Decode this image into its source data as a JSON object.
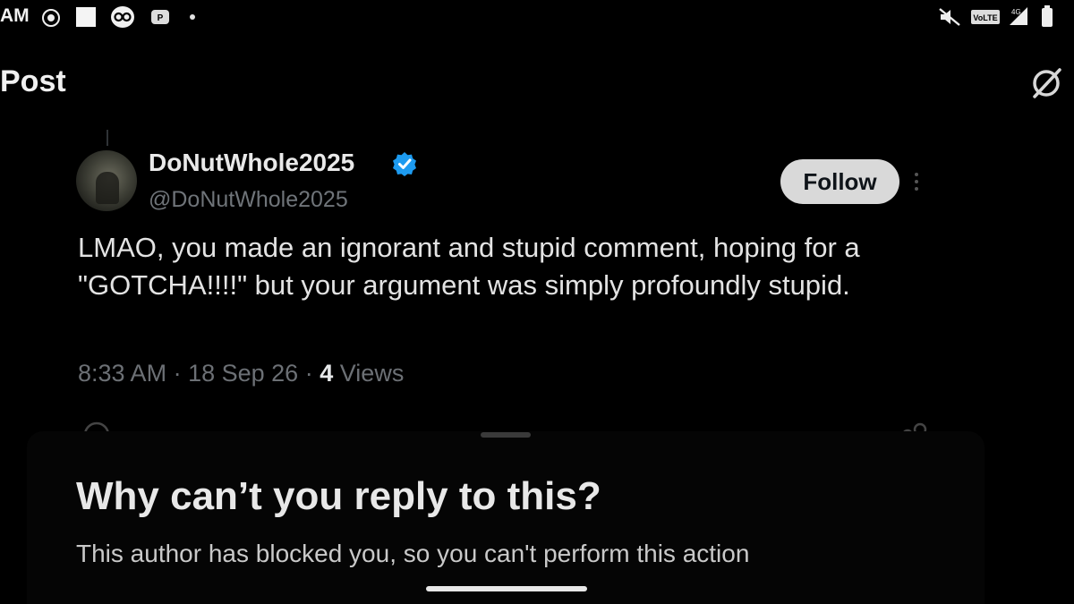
{
  "status_bar": {
    "time": "AM",
    "icons": [
      "focus-icon",
      "square-notification-icon",
      "link-app-icon",
      "game-app-icon",
      "dot-icon",
      "mute-icon",
      "volte-icon",
      "signal-icon",
      "battery-icon"
    ],
    "volte_label": "VoLTE"
  },
  "header": {
    "title": "Post",
    "grok_icon": "grok-icon"
  },
  "post": {
    "display_name": "DoNutWhole2025",
    "handle": "@DoNutWhole2025",
    "follow_label": "Follow",
    "text": "LMAO, you made an ignorant and stupid comment, hoping for a \"GOTCHA!!!!\" but your argument was simply profoundly stupid.",
    "time": "8:33 AM",
    "date": "18 Sep 26",
    "views_count": "4",
    "views_label": "Views",
    "separator": "·"
  },
  "sheet": {
    "title": "Why can’t you reply to this?",
    "body": "This author has blocked you, so you can't perform this action"
  },
  "colors": {
    "background": "#000000",
    "verified_blue": "#1d9bf0",
    "follow_bg": "#d9d9d9",
    "muted_text": "#6c7075"
  }
}
